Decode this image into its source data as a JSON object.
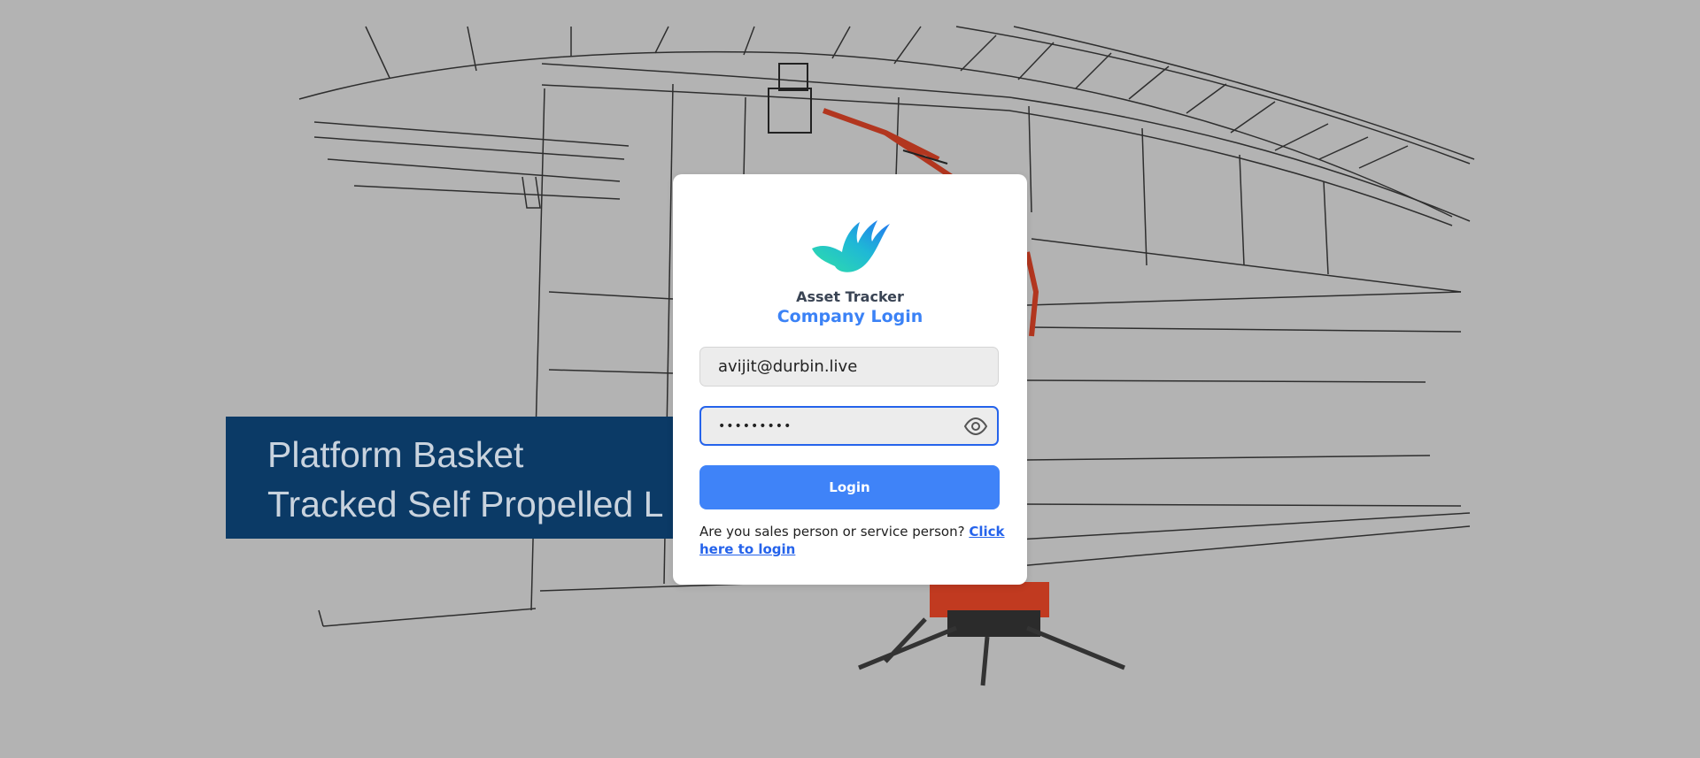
{
  "background": {
    "banner": {
      "line1": "Platform Basket",
      "line2": "Tracked Self Propelled L"
    }
  },
  "login": {
    "logo_icon": "bird-logo-icon",
    "app_name": "Asset Tracker",
    "title": "Company Login",
    "email": {
      "value": "avijit@durbin.live"
    },
    "password": {
      "value": "•••••••••",
      "toggle_icon": "eye-icon"
    },
    "submit_label": "Login",
    "helper_text": "Are you sales person or service person?",
    "helper_link": "Click here to login"
  },
  "colors": {
    "accent": "#3b82f6",
    "banner": "#0b3a66",
    "background": "#b3b3b3"
  }
}
